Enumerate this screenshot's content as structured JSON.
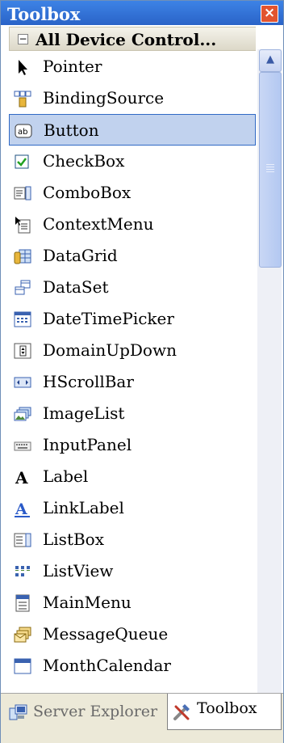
{
  "window": {
    "title": "Toolbox",
    "close_label": "×"
  },
  "category": {
    "toggle": "−",
    "label": "All Device Control..."
  },
  "items": [
    {
      "label": "Pointer",
      "icon": "pointer-icon"
    },
    {
      "label": "BindingSource",
      "icon": "binding-source-icon"
    },
    {
      "label": "Button",
      "icon": "button-icon",
      "selected": true
    },
    {
      "label": "CheckBox",
      "icon": "checkbox-icon"
    },
    {
      "label": "ComboBox",
      "icon": "combobox-icon"
    },
    {
      "label": "ContextMenu",
      "icon": "context-menu-icon"
    },
    {
      "label": "DataGrid",
      "icon": "datagrid-icon"
    },
    {
      "label": "DataSet",
      "icon": "dataset-icon"
    },
    {
      "label": "DateTimePicker",
      "icon": "datetimepicker-icon"
    },
    {
      "label": "DomainUpDown",
      "icon": "domain-updown-icon"
    },
    {
      "label": "HScrollBar",
      "icon": "hscrollbar-icon"
    },
    {
      "label": "ImageList",
      "icon": "imagelist-icon"
    },
    {
      "label": "InputPanel",
      "icon": "inputpanel-icon"
    },
    {
      "label": "Label",
      "icon": "label-icon"
    },
    {
      "label": "LinkLabel",
      "icon": "linklabel-icon"
    },
    {
      "label": "ListBox",
      "icon": "listbox-icon"
    },
    {
      "label": "ListView",
      "icon": "listview-icon"
    },
    {
      "label": "MainMenu",
      "icon": "mainmenu-icon"
    },
    {
      "label": "MessageQueue",
      "icon": "messagequeue-icon"
    },
    {
      "label": "MonthCalendar",
      "icon": "monthcalendar-icon"
    }
  ],
  "tabs": [
    {
      "label": "Server Explorer",
      "icon": "server-explorer-icon",
      "active": false
    },
    {
      "label": "Toolbox",
      "icon": "toolbox-icon",
      "active": true
    }
  ],
  "colors": {
    "titlebar": "#2a63c8",
    "selection": "#c1d2ee",
    "selection_border": "#316ac5"
  }
}
